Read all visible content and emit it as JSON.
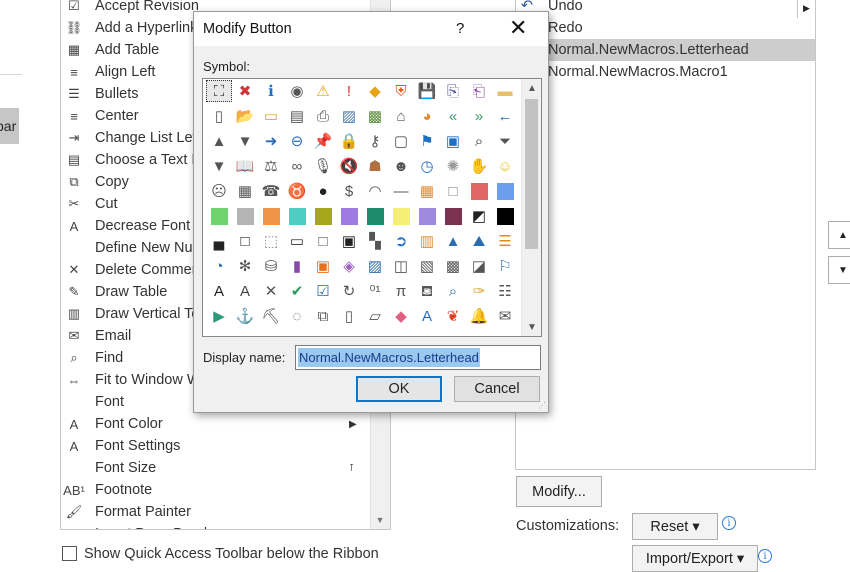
{
  "left_stub_text": "bar",
  "commands": [
    {
      "label": "Accept Revision",
      "icon": "check-doc-icon",
      "glyph": "☑"
    },
    {
      "label": "Add a Hyperlink",
      "icon": "hyperlink-icon",
      "glyph": "⛓"
    },
    {
      "label": "Add Table",
      "icon": "table-icon",
      "glyph": "▦"
    },
    {
      "label": "Align Left",
      "icon": "align-left-icon",
      "glyph": "≡"
    },
    {
      "label": "Bullets",
      "icon": "bullets-icon",
      "glyph": "☰"
    },
    {
      "label": "Center",
      "icon": "align-center-icon",
      "glyph": "≡"
    },
    {
      "label": "Change List Level",
      "icon": "list-level-icon",
      "glyph": "⇥"
    },
    {
      "label": "Choose a Text Box",
      "icon": "textbox-icon",
      "glyph": "▤"
    },
    {
      "label": "Copy",
      "icon": "copy-icon",
      "glyph": "⧉"
    },
    {
      "label": "Cut",
      "icon": "scissors-icon",
      "glyph": "✂"
    },
    {
      "label": "Decrease Font Size",
      "icon": "decrease-font-icon",
      "glyph": "A"
    },
    {
      "label": "Define New Number Format...",
      "icon": "",
      "glyph": ""
    },
    {
      "label": "Delete Comment",
      "icon": "delete-comment-icon",
      "glyph": "✕"
    },
    {
      "label": "Draw Table",
      "icon": "draw-table-icon",
      "glyph": "✎"
    },
    {
      "label": "Draw Vertical Text Box",
      "icon": "vertical-textbox-icon",
      "glyph": "▥"
    },
    {
      "label": "Email",
      "icon": "email-icon",
      "glyph": "✉"
    },
    {
      "label": "Find",
      "icon": "find-icon",
      "glyph": "⌕"
    },
    {
      "label": "Fit to Window Width",
      "icon": "fit-window-icon",
      "glyph": "⇔"
    },
    {
      "label": "Font",
      "icon": "",
      "glyph": ""
    },
    {
      "label": "Font Color",
      "icon": "font-color-icon",
      "glyph": "A"
    },
    {
      "label": "Font Settings",
      "icon": "font-settings-icon",
      "glyph": "A"
    },
    {
      "label": "Font Size",
      "icon": "",
      "glyph": ""
    },
    {
      "label": "Footnote",
      "icon": "footnote-icon",
      "glyph": "AB¹"
    },
    {
      "label": "Format Painter",
      "icon": "format-painter-icon",
      "glyph": "🖌"
    },
    {
      "label": "Insert Page Break",
      "icon": "",
      "glyph": ""
    }
  ],
  "qat_items": [
    {
      "label": "Undo",
      "icon": "undo-icon",
      "glyph": "↶"
    },
    {
      "label": "Redo",
      "icon": "",
      "glyph": ""
    },
    {
      "label": "Normal.NewMacros.Letterhead",
      "icon": "",
      "glyph": "",
      "selected": true
    },
    {
      "label": "Normal.NewMacros.Macro1",
      "icon": "",
      "glyph": ""
    }
  ],
  "modify_button_label": "Modify...",
  "customizations_label": "Customizations:",
  "reset_label": "Reset ▾",
  "import_export_label": "Import/Export ▾",
  "show_below_ribbon_label": "Show Quick Access Toolbar below the Ribbon",
  "dialog": {
    "title": "Modify Button",
    "help_glyph": "?",
    "close_glyph": "✕",
    "symbol_label": "Symbol:",
    "display_name_label": "Display name:",
    "display_name_value": "Normal.NewMacros.Letterhead",
    "ok_label": "OK",
    "cancel_label": "Cancel"
  },
  "symbol_rows": [
    [
      [
        "org-chart-icon",
        "⛶",
        "#333"
      ],
      [
        "error-icon",
        "✖",
        "#d13438"
      ],
      [
        "info-icon",
        "ℹ",
        "#1e6fc5"
      ],
      [
        "record-icon",
        "◉",
        "#555"
      ],
      [
        "warning-icon",
        "⚠",
        "#e8a317"
      ],
      [
        "exclamation-icon",
        "!",
        "#d13438"
      ],
      [
        "warning-diamond-icon",
        "◆",
        "#e8a317"
      ],
      [
        "shield-icon",
        "⛨",
        "#e8541c"
      ],
      [
        "save-icon",
        "💾",
        "#5a5a9c"
      ],
      [
        "save-as-icon",
        "⎘",
        "#5a5a9c"
      ],
      [
        "save-all-icon",
        "⎗",
        "#8a4aa8"
      ],
      [
        "folder-icon",
        "▬",
        "#e6c06a"
      ]
    ],
    [
      [
        "page-icon",
        "▯",
        "#555"
      ],
      [
        "open-folder-icon",
        "📂",
        "#e6b450"
      ],
      [
        "folder-open-icon",
        "▭",
        "#d9a63a"
      ],
      [
        "drawer-icon",
        "▤",
        "#555"
      ],
      [
        "printer-icon",
        "⎙",
        "#555"
      ],
      [
        "picture-icon",
        "▨",
        "#4a7ab0"
      ],
      [
        "picture2-icon",
        "▩",
        "#5a8a3a"
      ],
      [
        "home-icon",
        "⌂",
        "#555"
      ],
      [
        "pie-icon",
        "◕",
        "#e08a2e"
      ],
      [
        "rewind-icon",
        "«",
        "#3a9a6a"
      ],
      [
        "forward-icon",
        "»",
        "#3a9a6a"
      ],
      [
        "left-arrow-icon",
        "←",
        "#2b6cb0"
      ]
    ],
    [
      [
        "triangle-up-icon",
        "▲",
        "#555"
      ],
      [
        "triangle-down-icon",
        "▼",
        "#555"
      ],
      [
        "right-arrow-icon",
        "➜",
        "#2b6cb0"
      ],
      [
        "back-circle-icon",
        "⊖",
        "#2b6cb0"
      ],
      [
        "pin-icon",
        "📌",
        "#666"
      ],
      [
        "lock-icon",
        "🔒",
        "#d9a63a"
      ],
      [
        "key-icon",
        "⚷",
        "#555"
      ],
      [
        "document-icon",
        "▢",
        "#555"
      ],
      [
        "flag-icon",
        "⚑",
        "#1e6fc5"
      ],
      [
        "window-icon",
        "▣",
        "#1e6fc5"
      ],
      [
        "search-icon",
        "⌕",
        "#333"
      ],
      [
        "filter-icon",
        "⏷",
        "#555"
      ]
    ],
    [
      [
        "funnel-icon",
        "▼",
        "#555"
      ],
      [
        "book-icon",
        "📖",
        "#555"
      ],
      [
        "scales-icon",
        "⚖",
        "#555"
      ],
      [
        "rings-icon",
        "∞",
        "#555"
      ],
      [
        "microphone-icon",
        "🎙",
        "#555"
      ],
      [
        "mute-icon",
        "🔇",
        "#555"
      ],
      [
        "person-icon",
        "☗",
        "#b07040"
      ],
      [
        "people-icon",
        "☻",
        "#555"
      ],
      [
        "clock-icon",
        "◷",
        "#1e6fc5"
      ],
      [
        "sparkle-icon",
        "✺",
        "#999"
      ],
      [
        "hand-icon",
        "✋",
        "#555"
      ],
      [
        "smiley-icon",
        "☺",
        "#e8c020"
      ]
    ],
    [
      [
        "sad-face-icon",
        "☹",
        "#555"
      ],
      [
        "calculator-icon",
        "▦",
        "#555"
      ],
      [
        "phone-icon",
        "☎",
        "#555"
      ],
      [
        "piggy-bank-icon",
        "♉",
        "#555"
      ],
      [
        "eight-ball-icon",
        "●",
        "#222"
      ],
      [
        "dollar-icon",
        "$",
        "#555"
      ],
      [
        "eye-icon",
        "◠",
        "#555"
      ],
      [
        "dash-icon",
        "—",
        "#555"
      ],
      [
        "palette-icon",
        "▦",
        "#e08a2e"
      ],
      [
        "square-outline-icon",
        "□",
        "#888"
      ],
      [
        "swatch-red",
        "sw",
        "#e06666"
      ],
      [
        "swatch-blue",
        "sw",
        "#6d9eeb"
      ]
    ],
    [
      [
        "swatch-green",
        "sw",
        "#6ed46e"
      ],
      [
        "swatch-gray",
        "sw",
        "#b4b4b4"
      ],
      [
        "swatch-orange",
        "sw",
        "#f0944a"
      ],
      [
        "swatch-teal",
        "sw",
        "#4ecdc4"
      ],
      [
        "swatch-olive",
        "sw",
        "#a6a61a"
      ],
      [
        "swatch-purple",
        "sw",
        "#9e7be0"
      ],
      [
        "swatch-dark-green",
        "sw",
        "#1e8a6e"
      ],
      [
        "swatch-yellow",
        "sw",
        "#f5f075"
      ],
      [
        "swatch-lavender",
        "sw",
        "#a08ae0"
      ],
      [
        "swatch-maroon",
        "sw",
        "#7a3250"
      ],
      [
        "contrast-icon",
        "◩",
        "#222"
      ],
      [
        "swatch-black",
        "sw",
        "#000000"
      ]
    ],
    [
      [
        "half-square-icon",
        "▄",
        "#222"
      ],
      [
        "square-border-icon",
        "□",
        "#222"
      ],
      [
        "dotted-square-icon",
        "⬚",
        "#888"
      ],
      [
        "frame-icon",
        "▭",
        "#333"
      ],
      [
        "blank-square-icon",
        "□",
        "#555"
      ],
      [
        "filled-frame-icon",
        "▣",
        "#222"
      ],
      [
        "checker-icon",
        "▚",
        "#555"
      ],
      [
        "circle-arrow-icon",
        "➲",
        "#1e6fc5"
      ],
      [
        "bar-chart-icon",
        "▥",
        "#e08a2e"
      ],
      [
        "cone-icon",
        "▲",
        "#2b6cb0"
      ],
      [
        "mountain-icon",
        "⛰",
        "#2b6cb0"
      ],
      [
        "bar-graph-icon",
        "☰",
        "#e08a2e"
      ]
    ],
    [
      [
        "pie-chart-icon",
        "◔",
        "#2b6cb0"
      ],
      [
        "web-icon",
        "✻",
        "#555"
      ],
      [
        "database-icon",
        "⛁",
        "#555"
      ],
      [
        "purple-book-icon",
        "▮",
        "#8a4aa8"
      ],
      [
        "doc-orange-icon",
        "▣",
        "#e8701c"
      ],
      [
        "shapes-icon",
        "◈",
        "#a060c0"
      ],
      [
        "area-chart-icon",
        "▨",
        "#2b6cb0"
      ],
      [
        "page-fold-icon",
        "◫",
        "#555"
      ],
      [
        "contact-card-icon",
        "▧",
        "#555"
      ],
      [
        "picture-frame-icon",
        "▩",
        "#555"
      ],
      [
        "slash-icon",
        "◪",
        "#555"
      ],
      [
        "flag-red-icon",
        "⚐",
        "#2b6cb0"
      ]
    ],
    [
      [
        "text-a-icon",
        "A",
        "#222"
      ],
      [
        "shaded-a-icon",
        "A",
        "#444"
      ],
      [
        "x-mark-icon",
        "✕",
        "#555"
      ],
      [
        "check-mark-icon",
        "✔",
        "#2a9a5a"
      ],
      [
        "check-list-icon",
        "☑",
        "#2b6cb0"
      ],
      [
        "refresh-icon",
        "↻",
        "#555"
      ],
      [
        "binary-icon",
        "⁰¹",
        "#555"
      ],
      [
        "pi-icon",
        "π",
        "#555"
      ],
      [
        "bucket-icon",
        "⛾",
        "#555"
      ],
      [
        "magnifier-icon",
        "⌕",
        "#2b6cb0"
      ],
      [
        "broom-icon",
        "✑",
        "#d9a63a"
      ],
      [
        "list-icon",
        "☷",
        "#555"
      ]
    ],
    [
      [
        "play-icon",
        "▶",
        "#2a9a7a"
      ],
      [
        "anchor-icon",
        "⚓",
        "#555"
      ],
      [
        "toolbox-icon",
        "⛏",
        "#555"
      ],
      [
        "lasso-icon",
        "◌",
        "#555"
      ],
      [
        "copy-boxes-icon",
        "⧉",
        "#555"
      ],
      [
        "clipboard-icon",
        "▯",
        "#555"
      ],
      [
        "folder-outline-icon",
        "▱",
        "#555"
      ],
      [
        "eraser-icon",
        "◆",
        "#e06080"
      ],
      [
        "text-effect-icon",
        "A",
        "#2b6cb0"
      ],
      [
        "color-bird-icon",
        "❦",
        "#e04020"
      ],
      [
        "bell-icon",
        "🔔",
        "#e8a020"
      ],
      [
        "envelope-icon",
        "✉",
        "#555"
      ]
    ]
  ]
}
